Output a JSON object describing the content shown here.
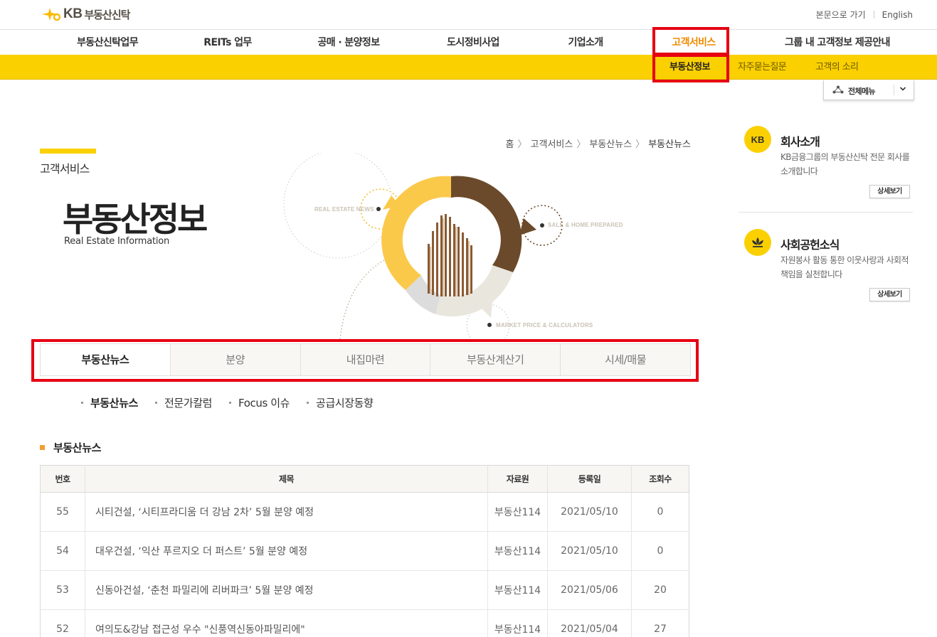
{
  "header": {
    "logo_kb": "KB",
    "logo_name": "부동산신탁",
    "util_links": [
      "본문으로 가기",
      "English"
    ]
  },
  "gnb": [
    "부동산신탁업무",
    "REITs 업무",
    "공매 · 분양정보",
    "도시정비사업",
    "기업소개",
    "고객서비스",
    "그룹 내 고객정보 제공안내"
  ],
  "gnb_active_index": 5,
  "subnav": [
    "부동산정보",
    "자주묻는질문",
    "고객의 소리"
  ],
  "all_menu_label": "전체메뉴",
  "breadcrumb": [
    "홈",
    "고객서비스",
    "부동산뉴스",
    "부동산뉴스"
  ],
  "page": {
    "section": "고객서비스",
    "title": "부동산정보",
    "subtitle": "Real Estate Information"
  },
  "visual_labels": {
    "news": "REAL ESTATE NEWS",
    "sale": "SALE & HOME PREPARED",
    "market": "MARKET PRICE & CALCULATORS"
  },
  "tabs": [
    "부동산뉴스",
    "분양",
    "내집마련",
    "부동산계산기",
    "시세/매물"
  ],
  "subtabs": [
    "부동산뉴스",
    "전문가칼럼",
    "Focus 이슈",
    "공급시장동향"
  ],
  "list_title": "부동산뉴스",
  "table": {
    "headers": [
      "번호",
      "제목",
      "자료원",
      "등록일",
      "조회수"
    ],
    "rows": [
      [
        "55",
        "시티건설, ‘시티프라디움 더 강남 2차’ 5월 분양 예정",
        "부동산114",
        "2021/05/10",
        "0"
      ],
      [
        "54",
        "대우건설, ‘익산 푸르지오 더 퍼스트’ 5월 분양 예정",
        "부동산114",
        "2021/05/10",
        "0"
      ],
      [
        "53",
        "신동아건설, ‘춘천 파밀리에 리버파크’ 5월 분양 예정",
        "부동산114",
        "2021/05/06",
        "20"
      ],
      [
        "52",
        "여의도&강남 접근성 우수 \"신풍역신동아파밀리에\"",
        "부동산114",
        "2021/05/04",
        "27"
      ]
    ]
  },
  "side": [
    {
      "title": "회사소개",
      "desc": "KB금융그룹의 부동산신탁 전문 회사를 소개합니다",
      "more": "상세보기",
      "icon_text": "KB"
    },
    {
      "title": "사회공헌소식",
      "desc": "자원봉사 활동 통한 이웃사랑과 사회적 책임을 실천합니다",
      "more": "상세보기"
    }
  ],
  "colors": {
    "brand_yellow": "#fbd000",
    "active_orange": "#f18a00",
    "highlight_red": "#e60012"
  }
}
